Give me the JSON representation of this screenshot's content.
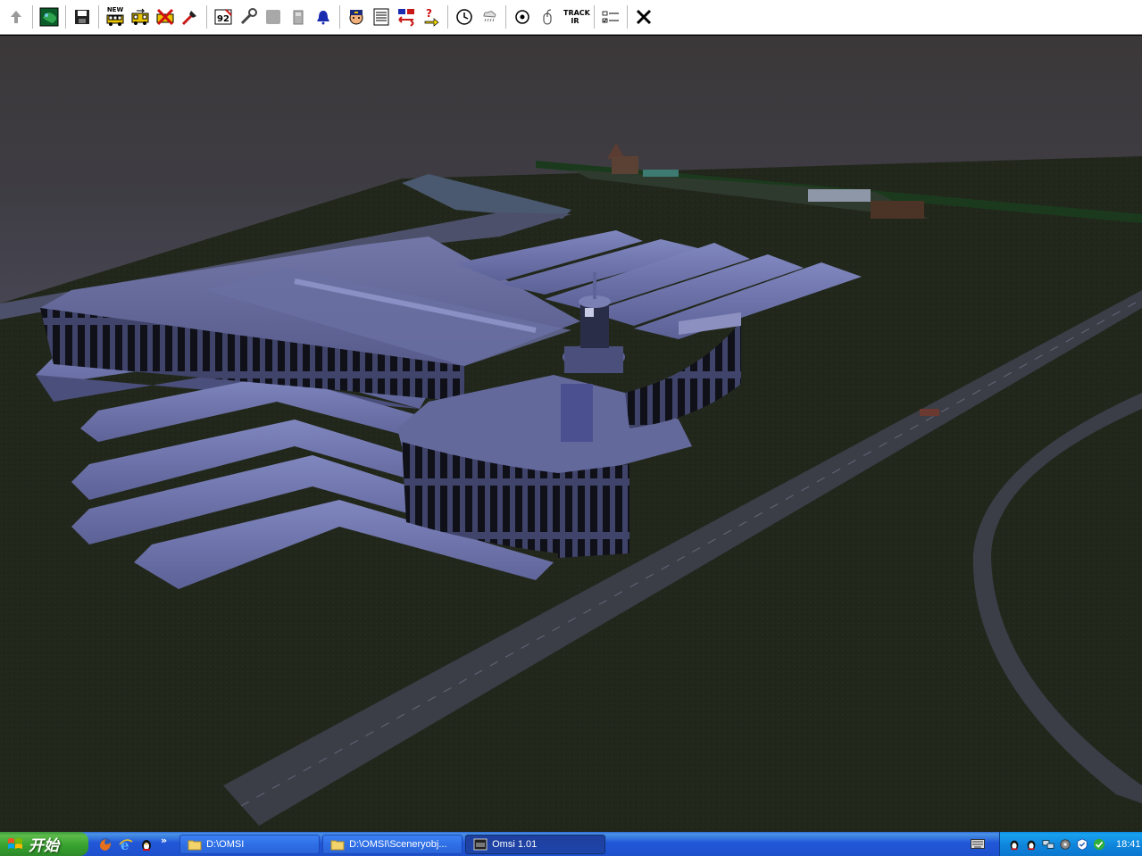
{
  "toolbar": {
    "buttons": [
      {
        "name": "up-arrow-icon"
      },
      {
        "name": "map-icon"
      },
      {
        "name": "save-icon"
      },
      {
        "name": "new-bus-icon",
        "label": "NEW"
      },
      {
        "name": "bus-swap-icon"
      },
      {
        "name": "delete-bus-icon"
      },
      {
        "name": "pointer-tool-icon"
      },
      {
        "name": "route-number-icon",
        "label": "92"
      },
      {
        "name": "wrench-icon"
      },
      {
        "name": "panel-icon"
      },
      {
        "name": "fuel-icon"
      },
      {
        "name": "bell-icon"
      },
      {
        "name": "driver-icon"
      },
      {
        "name": "timetable-icon"
      },
      {
        "name": "transfer-icon"
      },
      {
        "name": "help-icon"
      },
      {
        "name": "clock-icon"
      },
      {
        "name": "weather-icon"
      },
      {
        "name": "camera-icon"
      },
      {
        "name": "mouse-icon"
      },
      {
        "name": "trackir-icon",
        "label": "TRACK IR"
      },
      {
        "name": "options-icon"
      },
      {
        "name": "close-icon"
      }
    ]
  },
  "taskbar": {
    "start_label": "开始",
    "tasks": [
      {
        "label": "D:\\OMSI",
        "icon": "folder-icon"
      },
      {
        "label": "D:\\OMSI\\Sceneryobj...",
        "icon": "folder-icon"
      },
      {
        "label": "Omsi 1.01",
        "icon": "app-icon",
        "active": true
      }
    ],
    "clock": "18:41"
  }
}
